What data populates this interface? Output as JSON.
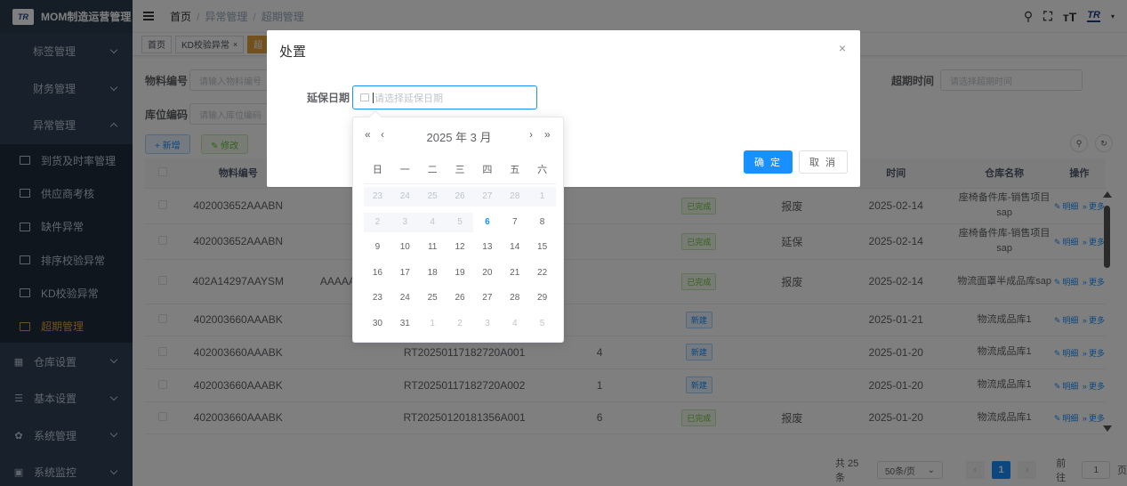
{
  "app": {
    "logo": "TR",
    "title": "MOM制造运营管理",
    "brand": "TR"
  },
  "sidebar": {
    "items": [
      {
        "label": "标签管理"
      },
      {
        "label": "财务管理"
      },
      {
        "label": "异常管理"
      }
    ],
    "sub": [
      {
        "label": "到货及时率管理"
      },
      {
        "label": "供应商考核"
      },
      {
        "label": "缺件异常"
      },
      {
        "label": "排序校验异常"
      },
      {
        "label": "KD校验异常"
      },
      {
        "label": "超期管理"
      }
    ],
    "bottom": [
      {
        "label": "仓库设置",
        "icon": "▦"
      },
      {
        "label": "基本设置",
        "icon": "☰"
      },
      {
        "label": "系统管理",
        "icon": "✿"
      },
      {
        "label": "系统监控",
        "icon": "▣"
      }
    ]
  },
  "breadcrumb": {
    "home": "首页",
    "sep": "/",
    "l2": "异常管理",
    "l3": "超期管理"
  },
  "tags": {
    "home": "首页",
    "kd": "KD校验异常",
    "kd_close": "×",
    "active": "超"
  },
  "filters": {
    "material_label": "物料编号",
    "material_ph": "请输入物料编号",
    "location_label": "库位编码",
    "location_ph": "请输入库位编码",
    "overdue_label": "超期时间",
    "overdue_ph": "请选择超期时间"
  },
  "toolbar": {
    "add": "+ 新增",
    "edit": "✎ 修改"
  },
  "table": {
    "headers": {
      "material": "物料编号",
      "time": "时间",
      "warehouse": "仓库名称",
      "ops": "操作"
    },
    "ops_detail": "明细",
    "ops_more": "更多",
    "rows": [
      {
        "code": "402003652AAABN",
        "col2": "",
        "col3": "",
        "qty": "",
        "status": "已完成",
        "status_color": "green",
        "handle": "报废",
        "date": "2025-02-14",
        "wh": "座椅备件库-销售项目sap"
      },
      {
        "code": "402003652AAABN",
        "col2": "",
        "col3": "",
        "qty": "",
        "status": "已完成",
        "status_color": "green",
        "handle": "延保",
        "date": "2025-02-14",
        "wh": "座椅备件库-销售项目sap"
      },
      {
        "code": "402A14297AAYSM",
        "col2": "AAAAA",
        "col3": "",
        "qty": "",
        "status": "已完成",
        "status_color": "green",
        "handle": "报废",
        "date": "2025-02-14",
        "wh": "物流面罩半成品库sap"
      },
      {
        "code": "402003660AAABK",
        "col2": "",
        "col3": "",
        "qty": "",
        "status": "新建",
        "status_color": "blue",
        "handle": "",
        "date": "2025-01-21",
        "wh": "物流成品库1"
      },
      {
        "code": "402003660AAABK",
        "col2": "",
        "col3": "RT20250117182720A001",
        "qty": "4",
        "status": "新建",
        "status_color": "blue",
        "handle": "",
        "date": "2025-01-20",
        "wh": "物流成品库1"
      },
      {
        "code": "402003660AAABK",
        "col2": "",
        "col3": "RT20250117182720A002",
        "qty": "1",
        "status": "新建",
        "status_color": "blue",
        "handle": "",
        "date": "2025-01-20",
        "wh": "物流成品库1"
      },
      {
        "code": "402003660AAABK",
        "col2": "",
        "col3": "RT20250120181356A001",
        "qty": "6",
        "status": "已完成",
        "status_color": "green",
        "handle": "报废",
        "date": "2025-01-20",
        "wh": "物流成品库1"
      }
    ]
  },
  "pager": {
    "total": "共 25 条",
    "size": "50条/页",
    "page": "1",
    "goto": "前往",
    "goto_val": "1",
    "suffix": "页"
  },
  "dialog": {
    "title": "处置",
    "close": "×",
    "date_label": "延保日期",
    "date_ph": "请选择延保日期",
    "ok": "确 定",
    "cancel": "取 消"
  },
  "picker": {
    "year_month": "2025 年  3 月",
    "prev_year": "«",
    "prev_month": "‹",
    "next_month": "›",
    "next_year": "»",
    "weekdays": [
      "日",
      "一",
      "二",
      "三",
      "四",
      "五",
      "六"
    ],
    "weeks": [
      [
        {
          "d": "23",
          "s": "dis"
        },
        {
          "d": "24",
          "s": "dis"
        },
        {
          "d": "25",
          "s": "dis"
        },
        {
          "d": "26",
          "s": "dis"
        },
        {
          "d": "27",
          "s": "dis"
        },
        {
          "d": "28",
          "s": "dis"
        },
        {
          "d": "1",
          "s": "dis"
        }
      ],
      [
        {
          "d": "2",
          "s": "dis"
        },
        {
          "d": "3",
          "s": "dis"
        },
        {
          "d": "4",
          "s": "dis"
        },
        {
          "d": "5",
          "s": "dis"
        },
        {
          "d": "6",
          "s": "today"
        },
        {
          "d": "7",
          "s": ""
        },
        {
          "d": "8",
          "s": ""
        }
      ],
      [
        {
          "d": "9",
          "s": ""
        },
        {
          "d": "10",
          "s": ""
        },
        {
          "d": "11",
          "s": ""
        },
        {
          "d": "12",
          "s": ""
        },
        {
          "d": "13",
          "s": ""
        },
        {
          "d": "14",
          "s": ""
        },
        {
          "d": "15",
          "s": ""
        }
      ],
      [
        {
          "d": "16",
          "s": ""
        },
        {
          "d": "17",
          "s": ""
        },
        {
          "d": "18",
          "s": ""
        },
        {
          "d": "19",
          "s": ""
        },
        {
          "d": "20",
          "s": ""
        },
        {
          "d": "21",
          "s": ""
        },
        {
          "d": "22",
          "s": ""
        }
      ],
      [
        {
          "d": "23",
          "s": ""
        },
        {
          "d": "24",
          "s": ""
        },
        {
          "d": "25",
          "s": ""
        },
        {
          "d": "26",
          "s": ""
        },
        {
          "d": "27",
          "s": ""
        },
        {
          "d": "28",
          "s": ""
        },
        {
          "d": "29",
          "s": ""
        }
      ],
      [
        {
          "d": "30",
          "s": ""
        },
        {
          "d": "31",
          "s": ""
        },
        {
          "d": "1",
          "s": "oth"
        },
        {
          "d": "2",
          "s": "oth"
        },
        {
          "d": "3",
          "s": "oth"
        },
        {
          "d": "4",
          "s": "oth"
        },
        {
          "d": "5",
          "s": "oth"
        }
      ]
    ]
  },
  "colors": {
    "primary": "#1890ff",
    "sidebar": "#304156",
    "active": "#e6a23c"
  }
}
